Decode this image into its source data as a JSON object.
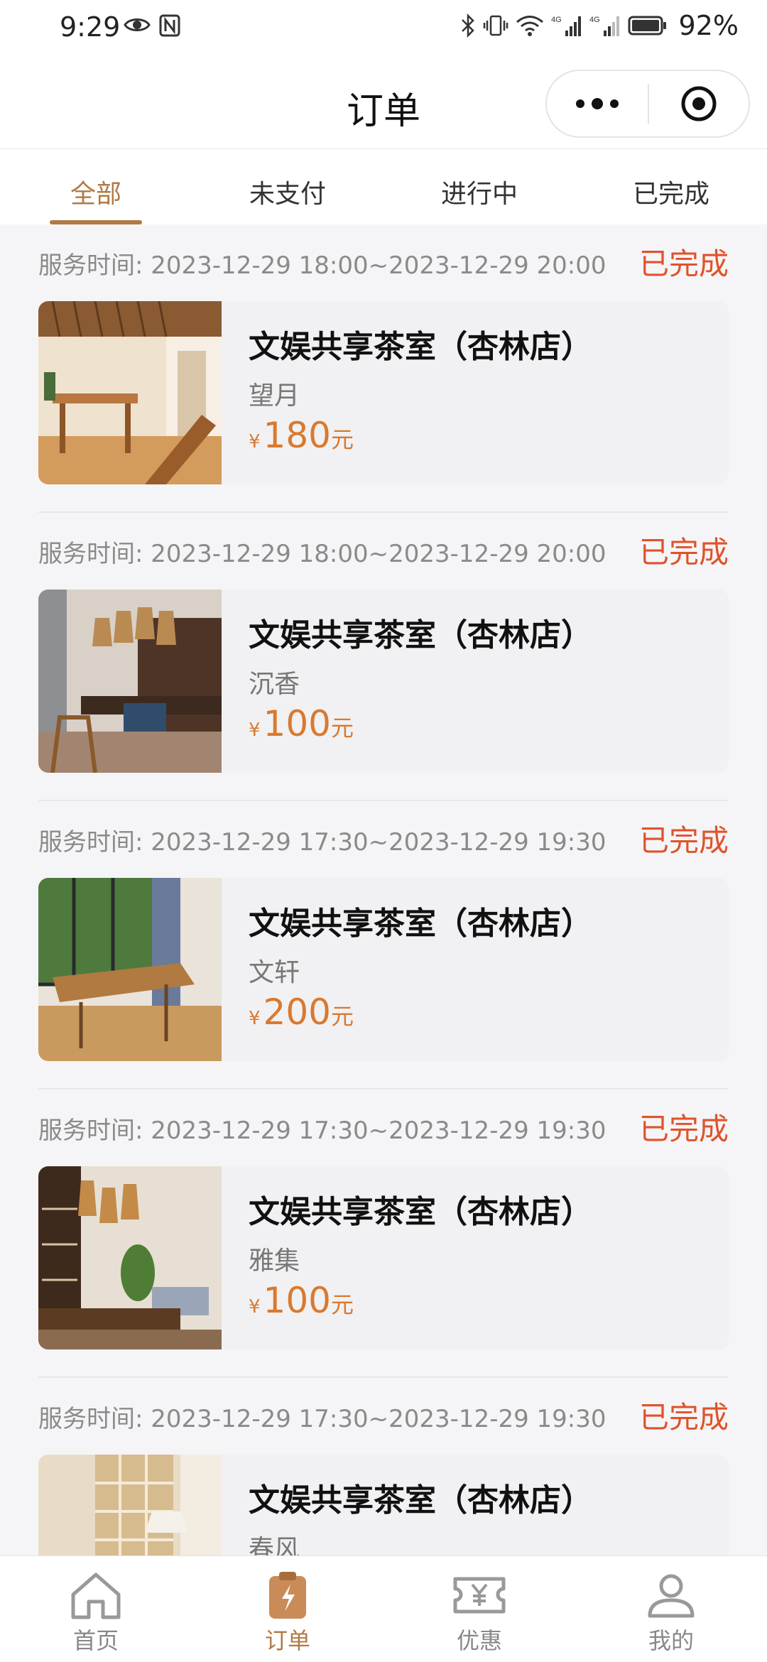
{
  "status_bar": {
    "time": "9:29",
    "battery": "92%",
    "icons": [
      "eye-icon",
      "nfc-icon",
      "bluetooth-icon",
      "vibrate-icon",
      "wifi-icon",
      "signal-4g-icon",
      "signal-4g-icon",
      "battery-icon"
    ]
  },
  "nav": {
    "title": "订单",
    "more_icon": "more-dots-icon",
    "close_icon": "target-close-icon"
  },
  "tabs": [
    {
      "label": "全部",
      "active": true
    },
    {
      "label": "未支付",
      "active": false
    },
    {
      "label": "进行中",
      "active": false
    },
    {
      "label": "已完成",
      "active": false
    }
  ],
  "orders": [
    {
      "service_time": "服务时间: 2023-12-29 18:00~2023-12-29 20:00",
      "status": "已完成",
      "store": "文娱共享茶室（杏林店）",
      "room": "望月",
      "currency": "¥",
      "price": "180",
      "unit": "元"
    },
    {
      "service_time": "服务时间: 2023-12-29 18:00~2023-12-29 20:00",
      "status": "已完成",
      "store": "文娱共享茶室（杏林店）",
      "room": "沉香",
      "currency": "¥",
      "price": "100",
      "unit": "元"
    },
    {
      "service_time": "服务时间: 2023-12-29 17:30~2023-12-29 19:30",
      "status": "已完成",
      "store": "文娱共享茶室（杏林店）",
      "room": "文轩",
      "currency": "¥",
      "price": "200",
      "unit": "元"
    },
    {
      "service_time": "服务时间: 2023-12-29 17:30~2023-12-29 19:30",
      "status": "已完成",
      "store": "文娱共享茶室（杏林店）",
      "room": "雅集",
      "currency": "¥",
      "price": "100",
      "unit": "元"
    },
    {
      "service_time": "服务时间: 2023-12-29 17:30~2023-12-29 19:30",
      "status": "已完成",
      "store": "文娱共享茶室（杏林店）",
      "room": "春风",
      "currency": "",
      "price": "",
      "unit": ""
    }
  ],
  "tabbar": [
    {
      "label": "首页",
      "icon": "home-icon",
      "active": false
    },
    {
      "label": "订单",
      "icon": "order-clipboard-icon",
      "active": true
    },
    {
      "label": "优惠",
      "icon": "coupon-yen-icon",
      "active": false
    },
    {
      "label": "我的",
      "icon": "user-icon",
      "active": false
    }
  ],
  "colors": {
    "accent": "#b07a45",
    "status_done": "#e0532a",
    "price": "#d9792f",
    "background": "#f5f5f7"
  }
}
